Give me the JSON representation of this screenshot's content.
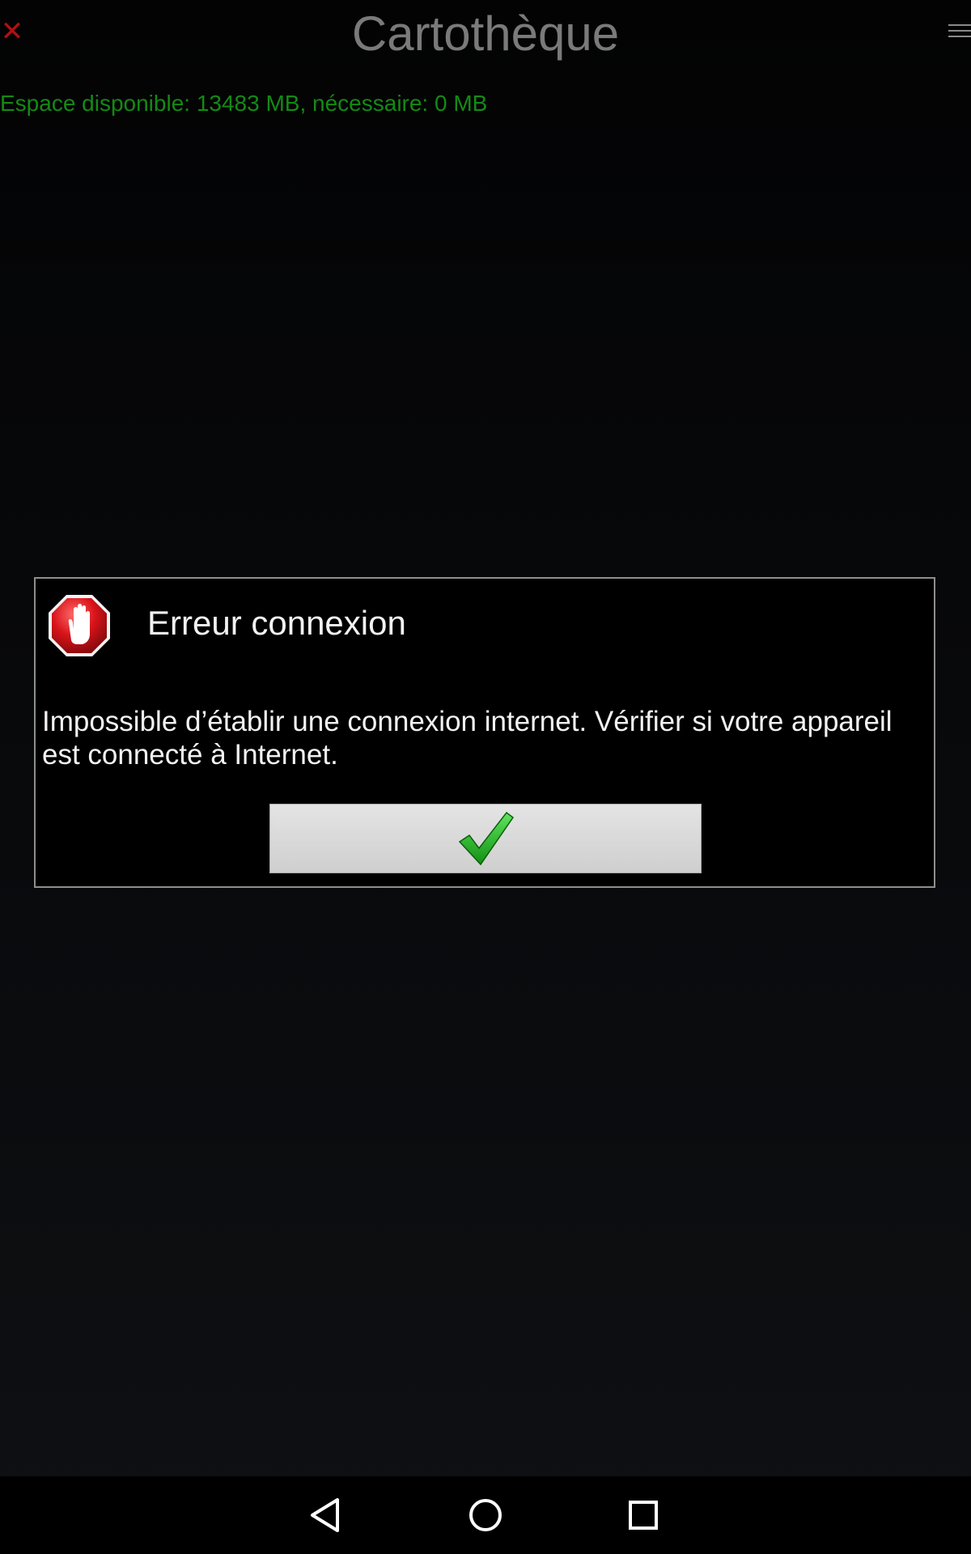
{
  "header": {
    "title": "Cartothèque",
    "close_icon": "close-icon",
    "menu_icon": "menu-icon"
  },
  "storage": {
    "text": "Espace disponible: 13483 MB, nécessaire: 0 MB"
  },
  "dialog": {
    "title": "Erreur connexion",
    "message": "Impossible d’établir une connexion internet. Vérifier si votre appareil est connecté à Internet.",
    "icon": "stop-hand-icon",
    "ok_icon": "check-icon"
  },
  "navbar": {
    "back_icon": "back-icon",
    "home_icon": "home-icon",
    "recents_icon": "recents-icon"
  },
  "colors": {
    "background": "#08090b",
    "title": "#7a7a7a",
    "storage_text": "#148a14",
    "close": "#b3100f",
    "dialog_border": "#8e8e8e",
    "check": "#22b422"
  }
}
